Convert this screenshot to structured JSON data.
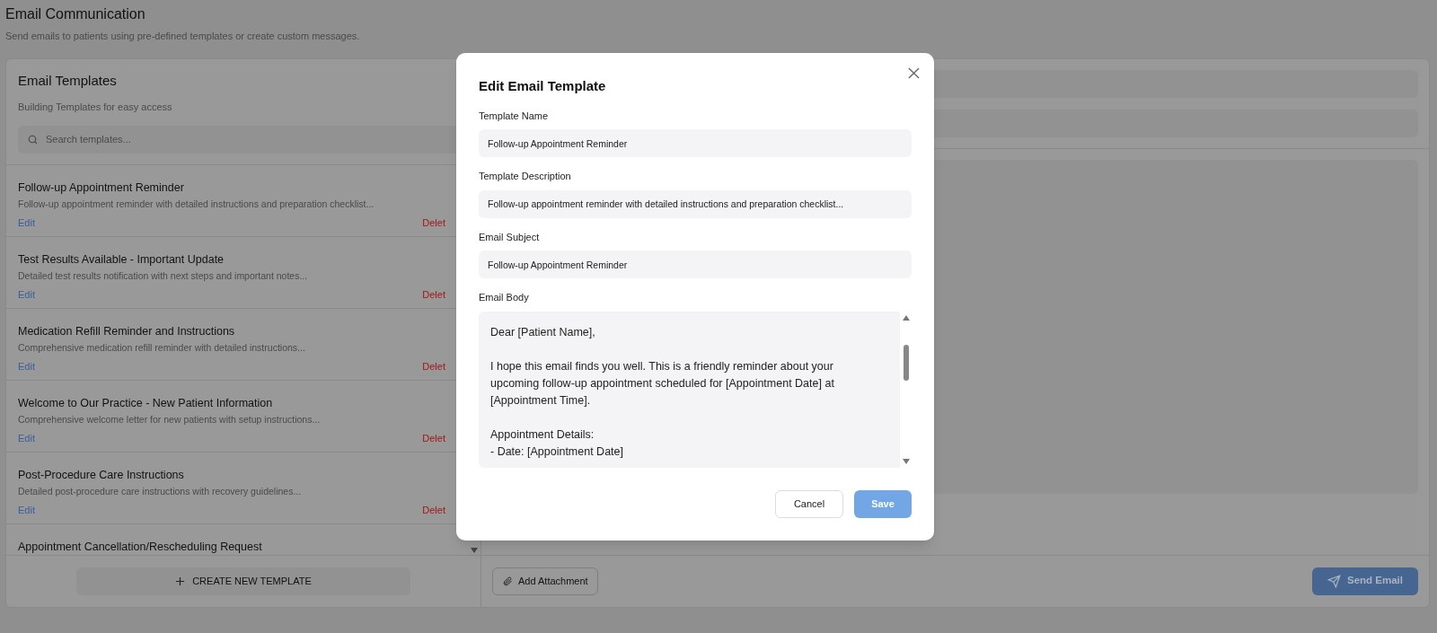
{
  "page": {
    "title": "Email Communication",
    "subtitle": "Send emails to patients using pre-defined templates or create custom messages."
  },
  "templates_panel": {
    "title": "Email Templates",
    "subtitle": "Building Templates for easy access",
    "search": {
      "placeholder": "Search templates..."
    },
    "items": [
      {
        "name": "Follow-up Appointment Reminder",
        "description": "Follow-up appointment reminder with detailed instructions and preparation checklist...",
        "edit": "Edit",
        "delete": "Delet"
      },
      {
        "name": "Test Results Available - Important Update",
        "description": "Detailed test results notification with next steps and important notes...",
        "edit": "Edit",
        "delete": "Delet"
      },
      {
        "name": "Medication Refill Reminder and Instructions",
        "description": "Comprehensive medication refill reminder with detailed instructions...",
        "edit": "Edit",
        "delete": "Delet"
      },
      {
        "name": "Welcome to Our Practice - New Patient Information",
        "description": "Comprehensive welcome letter for new patients with setup instructions...",
        "edit": "Edit",
        "delete": "Delet"
      },
      {
        "name": "Post-Procedure Care Instructions",
        "description": "Detailed post-procedure care instructions with recovery guidelines...",
        "edit": "Edit",
        "delete": "Delet"
      },
      {
        "name": "Appointment Cancellation/Rescheduling Request"
      }
    ],
    "create_button": "CREATE NEW TEMPLATE"
  },
  "compose_panel": {
    "attachment_button": "Add Attachment",
    "send_button": "Send Email"
  },
  "modal": {
    "title": "Edit Email Template",
    "fields": [
      {
        "label": "Template Name",
        "value": "Follow-up Appointment Reminder"
      },
      {
        "label": "Template Description",
        "value": "Follow-up appointment reminder with detailed instructions and preparation checklist..."
      },
      {
        "label": "Email Subject",
        "value": "Follow-up Appointment Reminder"
      }
    ],
    "body": {
      "label": "Email Body",
      "paragraphs": [
        [
          "Dear [Patient Name],"
        ],
        [
          "I hope this email finds you well. This is a friendly reminder about your upcoming follow-up appointment scheduled for [Appointment Date] at [Appointment Time]."
        ],
        [
          "Appointment Details:",
          "- Date: [Appointment Date]"
        ]
      ]
    },
    "cancel_button": "Cancel",
    "save_button": "Save"
  }
}
